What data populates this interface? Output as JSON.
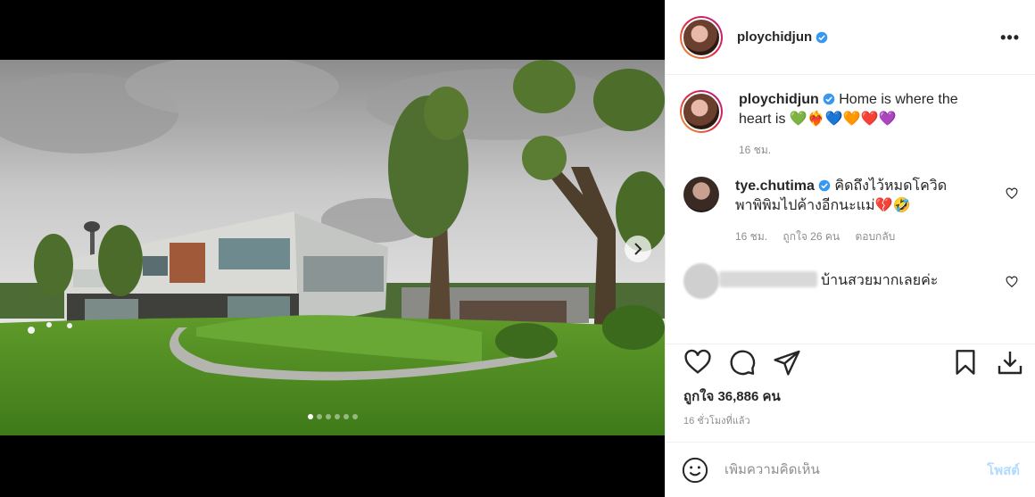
{
  "post": {
    "username": "ploychidjun",
    "more_label": "•••"
  },
  "caption": {
    "username": "ploychidjun",
    "text": "Home is where the heart is 💚❤️‍🔥💙🧡❤️💜",
    "time": "16 ชม."
  },
  "comments": [
    {
      "username": "tye.chutima",
      "text": "คิดถึงไว้หมดโควิด พาพิพิมไปค้างอีกนะแม่💔🤣",
      "time": "16 ชม.",
      "likes": "ถูกใจ 26 คน",
      "reply": "ตอบกลับ"
    },
    {
      "username": "",
      "text": "บ้านสวยมากเลยค่ะ"
    }
  ],
  "likes_text": "ถูกใจ 36,886 คน",
  "timestamp": "16 ชั่วโมงที่แล้ว",
  "add_comment": {
    "placeholder": "เพิ่มความคิดเห็น",
    "post_label": "โพสต์"
  },
  "carousel": {
    "count": 6,
    "active": 0
  },
  "colors": {
    "verified": "#3897f0",
    "post_disabled": "#b3dbff",
    "muted": "#8e8e8e"
  }
}
